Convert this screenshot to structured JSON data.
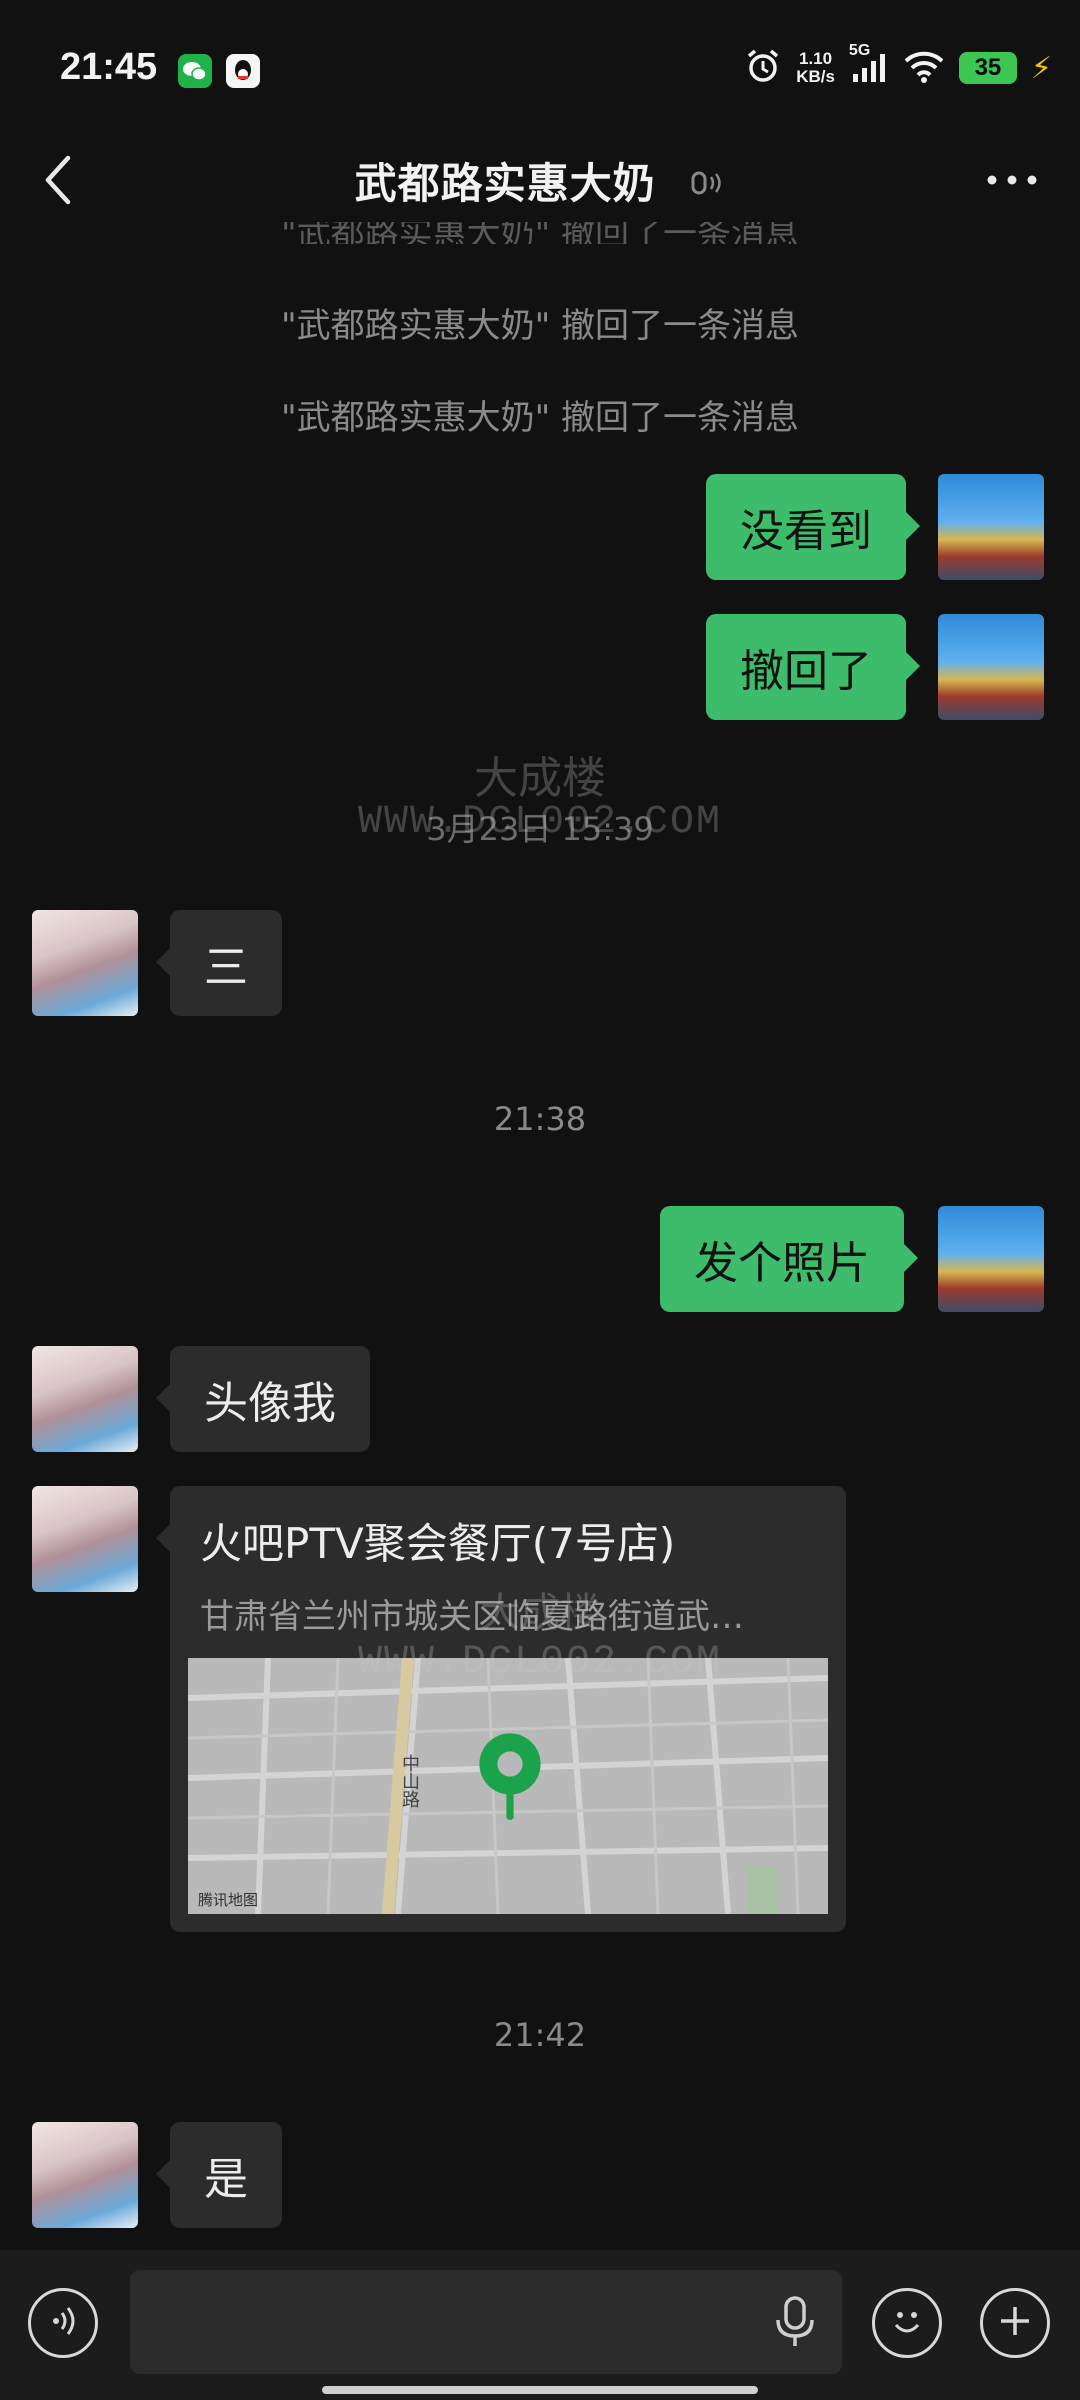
{
  "status_bar": {
    "time": "21:45",
    "net_speed_value": "1.10",
    "net_speed_unit": "KB/s",
    "network": "5G",
    "battery": "35"
  },
  "header": {
    "title": "武都路实惠大奶",
    "back_icon": "chevron-left-icon",
    "muted_icon": "speaker-muted-icon",
    "more_icon": "more-dots-icon"
  },
  "messages": {
    "recall_1": "\"武都路实惠大奶\" 撤回了一条消息",
    "recall_2": "\"武都路实惠大奶\" 撤回了一条消息",
    "sent_1": "没看到",
    "sent_2": "撤回了",
    "timestamp_1": "3月23日 15:39",
    "recv_1": "三",
    "timestamp_2": "21:38",
    "sent_3": "发个照片",
    "recv_2": "头像我",
    "location": {
      "name": "火吧PTV聚会餐厅(7号店)",
      "address": "甘肃省兰州市城关区临夏路街道武…",
      "map_credit": "腾讯地图",
      "street_label": "中山路"
    },
    "timestamp_3": "21:42",
    "recv_3": "是"
  },
  "watermark": {
    "text": "大成楼",
    "url": "WWW.DCL002.COM"
  },
  "input_bar": {
    "voice_icon": "voice-mode-icon",
    "mic_icon": "microphone-icon",
    "emoji_icon": "emoji-icon",
    "plus_icon": "plus-icon",
    "draft": ""
  },
  "colors": {
    "background": "#111111",
    "sent_bubble": "#3dbd6c",
    "received_bubble": "#2c2c2c",
    "accent_pin": "#1aa34a"
  }
}
